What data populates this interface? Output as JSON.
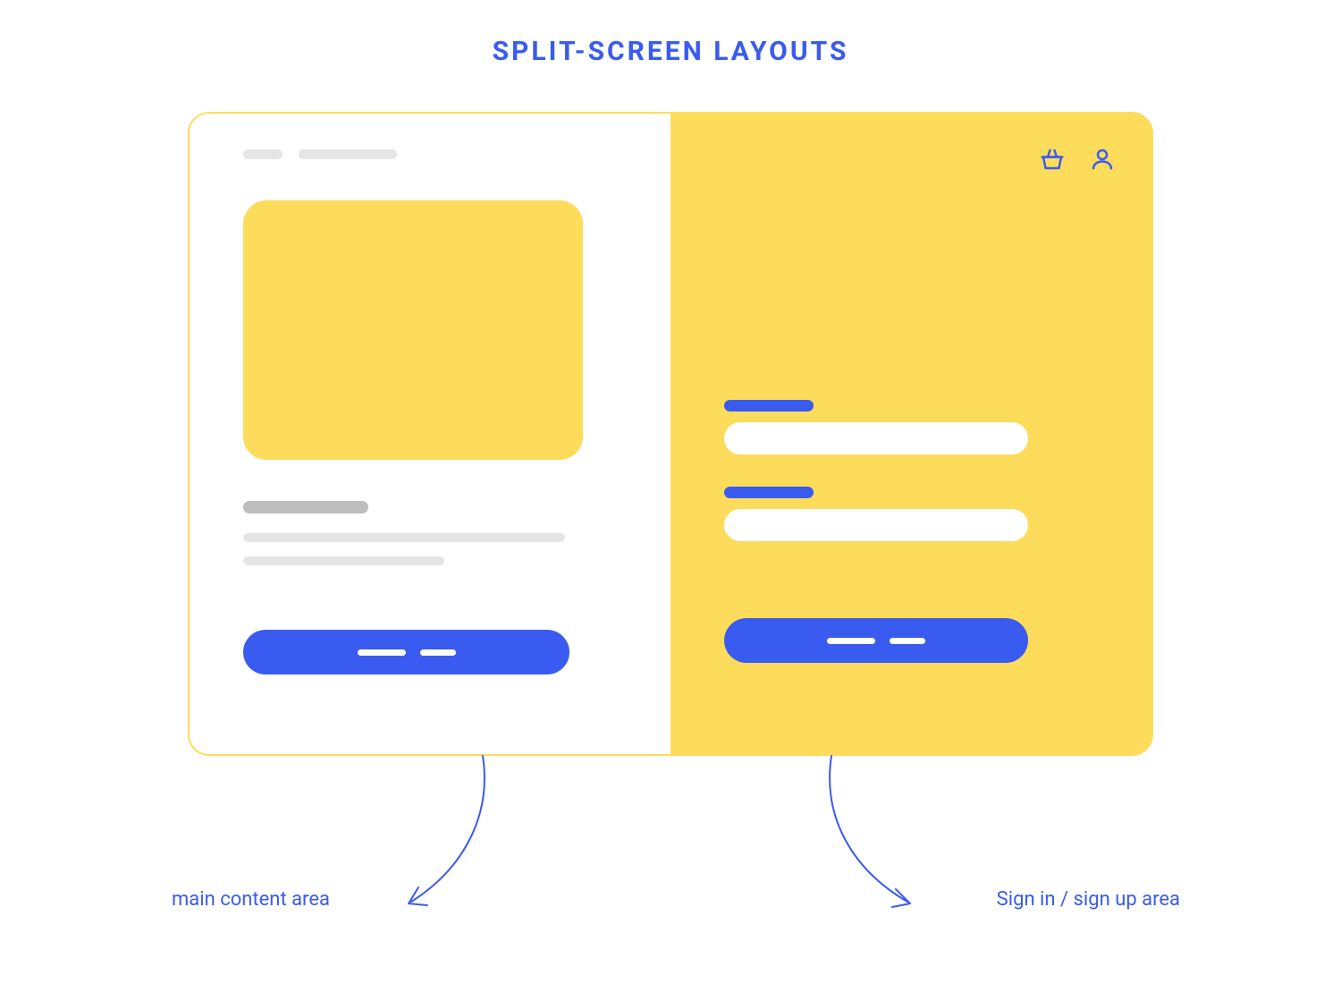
{
  "title": "SPLIT-SCREEN LAYOUTS",
  "annotations": {
    "left_label": "main content area",
    "right_label": "Sign in / sign up area"
  },
  "icons": {
    "basket": "basket-icon",
    "user": "user-icon"
  },
  "colors": {
    "primary_blue": "#3A5BF0",
    "accent_yellow": "#FDDC5C",
    "placeholder_gray": "#E5E5E5",
    "placeholder_dark_gray": "#BDBDBD",
    "white": "#FFFFFF"
  },
  "layout": {
    "left_panel": "main content area with hero image, heading, body text, and CTA button (all placeholder wireframe bars)",
    "right_panel": "sign in / sign up area with two labeled input fields and CTA button (all placeholder wireframe bars)"
  }
}
